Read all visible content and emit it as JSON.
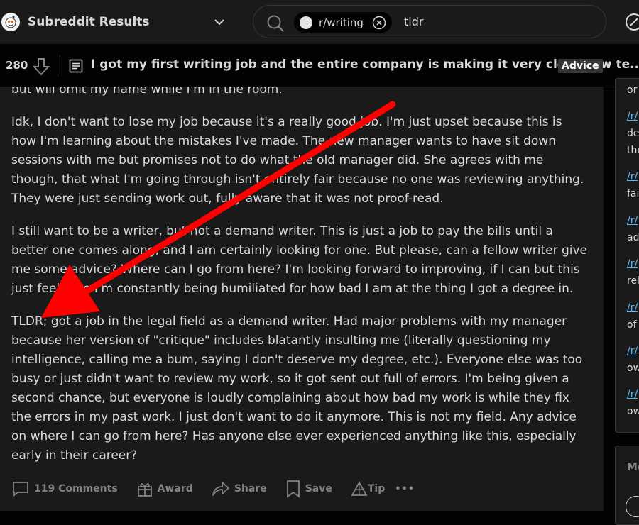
{
  "header": {
    "community_label": "Subreddit Results",
    "search_chip": "r/writing",
    "search_query": "tldr"
  },
  "post": {
    "vote_count": "280",
    "title": "I got my first writing job and the entire company is making it very clear how te...",
    "flair": "Advice",
    "paragraphs": [
      "but will omit my name while I'm in the room.",
      "Idk, I don't want to lose my job because it's a really good job. I'm just upset because this is how I'm learning about the mistakes I've made. The new manager wants to have sit down sessions with me but promises not to do what the old manager did. She agrees with me though, that what I'm going through isn't entirely fair because no one was reviewing anything. They were just sending work out, fully aware that it was not proof-read.",
      "I still want to be a writer, but not a demand writer. This is just a job to pay the bills until a better one comes along, and I am certainly looking for one. But please, can a fellow writer give me some advice? Where can I go from here? I'm looking forward to improving, if I can but this just feels like I'm constantly being humiliated for how bad I am at the thing I got a degree in.",
      "TLDR; got a job in the legal field as a demand writer. Had major problems with my manager because her version of \"critique\" includes blatantly insulting me (literally questioning my intelligence, calling me a bum, saying I don't deserve my degree, etc.). Everyone else was too busy or just didn't want to review my work, so it got sent out full of errors. I'm being given a second chance, but everyone is loudly complaining about how bad my work is while they fix the errors in my past work. I just don't want to do it anymore. This is not my field. Any advice on where I can go from here? Has anyone else ever experienced anything like this, especially early in their career?"
    ],
    "actions": {
      "comments": "119 Comments",
      "award": "Award",
      "share": "Share",
      "save": "Save",
      "tip": "Tip",
      "more": "•••"
    }
  },
  "sidebar": {
    "top_text": "or",
    "items": [
      {
        "link": "/r/",
        "text": "de"
      },
      {
        "link": "",
        "text": "the"
      },
      {
        "link": "/r/",
        "text": "fai"
      },
      {
        "link": "/r/",
        "text": "ad"
      },
      {
        "link": "/r/",
        "text": "rel"
      },
      {
        "link": "/r/",
        "text": "of"
      },
      {
        "link": "/r/",
        "text": "ow"
      },
      {
        "link": "/r/",
        "text": "ow"
      }
    ],
    "second_heading": "Mo"
  },
  "colors": {
    "background": "#030303",
    "card": "#1a1a1b",
    "text": "#d7dadc",
    "muted": "#818384",
    "link": "#4fbcff",
    "annotation_arrow": "#ff0000"
  }
}
